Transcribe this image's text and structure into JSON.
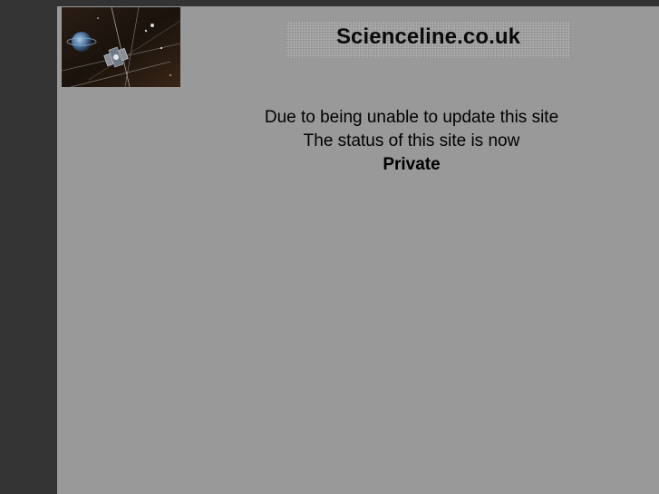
{
  "header": {
    "site_title": "Scienceline.co.uk",
    "logo": "satellite-space-image"
  },
  "main": {
    "line1": "Due to being unable to update this site",
    "line2": "The status of this site is now",
    "status": "Private"
  },
  "colors": {
    "outer_background": "#333333",
    "page_background": "#999999",
    "title_box": "#a4a4a4",
    "text": "#000000"
  }
}
